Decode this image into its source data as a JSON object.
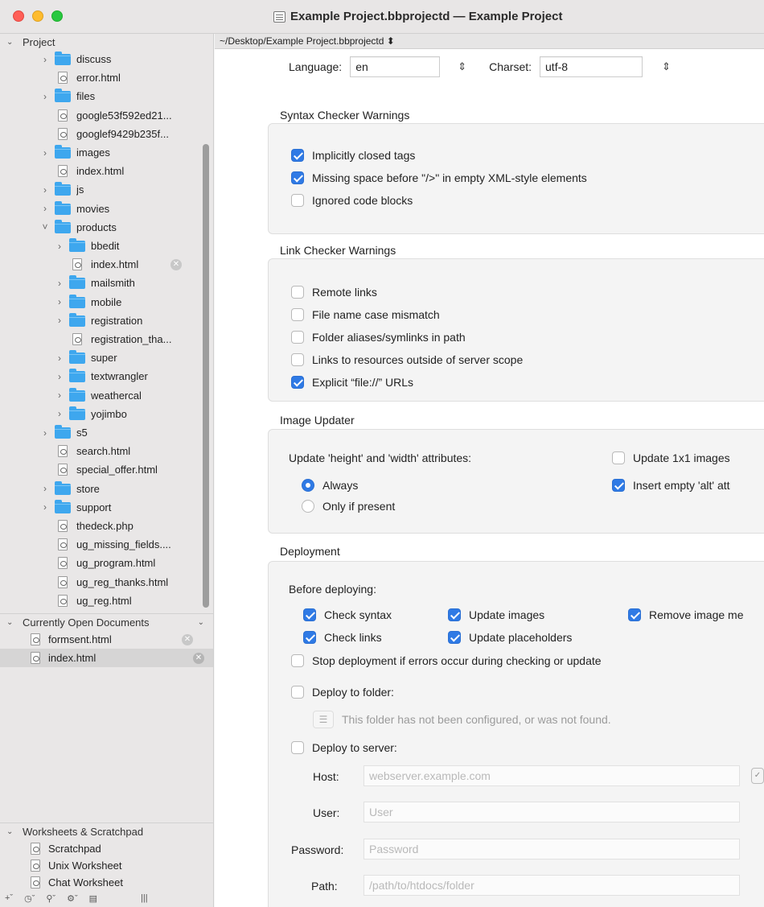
{
  "window": {
    "title": "Example Project.bbprojectd — Example Project"
  },
  "sidebar": {
    "project_header": "Project",
    "tree": [
      {
        "label": "discuss",
        "type": "folder",
        "level": 1,
        "expanded": false
      },
      {
        "label": "error.html",
        "type": "file",
        "level": 1
      },
      {
        "label": "files",
        "type": "folder",
        "level": 1,
        "expanded": false
      },
      {
        "label": "google53f592ed21...",
        "type": "file",
        "level": 1
      },
      {
        "label": "googlef9429b235f...",
        "type": "file",
        "level": 1
      },
      {
        "label": "images",
        "type": "folder",
        "level": 1,
        "expanded": false
      },
      {
        "label": "index.html",
        "type": "file",
        "level": 1
      },
      {
        "label": "js",
        "type": "folder",
        "level": 1,
        "expanded": false
      },
      {
        "label": "movies",
        "type": "folder",
        "level": 1,
        "expanded": false
      },
      {
        "label": "products",
        "type": "folder",
        "level": 1,
        "expanded": true
      },
      {
        "label": "bbedit",
        "type": "folder",
        "level": 2,
        "expanded": false
      },
      {
        "label": "index.html",
        "type": "file",
        "level": 2,
        "closable": true
      },
      {
        "label": "mailsmith",
        "type": "folder",
        "level": 2,
        "expanded": false
      },
      {
        "label": "mobile",
        "type": "folder",
        "level": 2,
        "expanded": false
      },
      {
        "label": "registration",
        "type": "folder",
        "level": 2,
        "expanded": false
      },
      {
        "label": "registration_tha...",
        "type": "file",
        "level": 2
      },
      {
        "label": "super",
        "type": "folder",
        "level": 2,
        "expanded": false
      },
      {
        "label": "textwrangler",
        "type": "folder",
        "level": 2,
        "expanded": false
      },
      {
        "label": "weathercal",
        "type": "folder",
        "level": 2,
        "expanded": false
      },
      {
        "label": "yojimbo",
        "type": "folder",
        "level": 2,
        "expanded": false
      },
      {
        "label": "s5",
        "type": "folder",
        "level": 1,
        "expanded": false
      },
      {
        "label": "search.html",
        "type": "file",
        "level": 1
      },
      {
        "label": "special_offer.html",
        "type": "file",
        "level": 1
      },
      {
        "label": "store",
        "type": "folder",
        "level": 1,
        "expanded": false
      },
      {
        "label": "support",
        "type": "folder",
        "level": 1,
        "expanded": false
      },
      {
        "label": "thedeck.php",
        "type": "file",
        "level": 1
      },
      {
        "label": "ug_missing_fields....",
        "type": "file",
        "level": 1
      },
      {
        "label": "ug_program.html",
        "type": "file",
        "level": 1
      },
      {
        "label": "ug_reg_thanks.html",
        "type": "file",
        "level": 1
      },
      {
        "label": "ug_reg.html",
        "type": "file",
        "level": 1
      }
    ],
    "open_docs_header": "Currently Open Documents",
    "open_docs": [
      {
        "label": "formsent.html",
        "selected": false
      },
      {
        "label": "index.html",
        "selected": true
      }
    ],
    "worksheets_header": "Worksheets & Scratchpad",
    "worksheets": [
      "Scratchpad",
      "Unix Worksheet",
      "Chat Worksheet"
    ]
  },
  "pathbar": {
    "path": "~/Desktop/Example Project.bbprojectd ⬍"
  },
  "settings": {
    "language_label": "Language:",
    "language_value": "en",
    "charset_label": "Charset:",
    "charset_value": "utf-8",
    "syntax": {
      "title": "Syntax Checker Warnings",
      "items": [
        {
          "label": "Implicitly closed tags",
          "checked": true
        },
        {
          "label": "Missing space before \"/>\" in empty XML-style elements",
          "checked": true
        },
        {
          "label": "Ignored code blocks",
          "checked": false
        }
      ]
    },
    "links": {
      "title": "Link Checker Warnings",
      "items": [
        {
          "label": "Remote links",
          "checked": false
        },
        {
          "label": "File name case mismatch",
          "checked": false
        },
        {
          "label": "Folder aliases/symlinks in path",
          "checked": false
        },
        {
          "label": "Links to resources outside of server scope",
          "checked": false
        },
        {
          "label": "Explicit “file://” URLs",
          "checked": true
        }
      ]
    },
    "image_updater": {
      "title": "Image Updater",
      "attrs_label": "Update 'height' and 'width' attributes:",
      "always": "Always",
      "only_if_present": "Only if present",
      "update_1x1": "Update 1x1 images",
      "insert_alt": "Insert empty 'alt' att"
    },
    "deployment": {
      "title": "Deployment",
      "before_label": "Before deploying:",
      "check_syntax": "Check syntax",
      "check_links": "Check links",
      "update_images": "Update images",
      "update_placeholders": "Update placeholders",
      "remove_image_meta": "Remove image me",
      "stop_on_errors": "Stop deployment if errors occur during checking or update",
      "deploy_to_folder": "Deploy to folder:",
      "folder_not_configured": "This folder has not been configured, or was not found.",
      "deploy_to_server": "Deploy to server:",
      "host_label": "Host:",
      "host_placeholder": "webserver.example.com",
      "user_label": "User:",
      "user_placeholder": "User",
      "password_label": "Password:",
      "password_placeholder": "Password",
      "path_label": "Path:",
      "path_placeholder": "/path/to/htdocs/folder"
    }
  }
}
